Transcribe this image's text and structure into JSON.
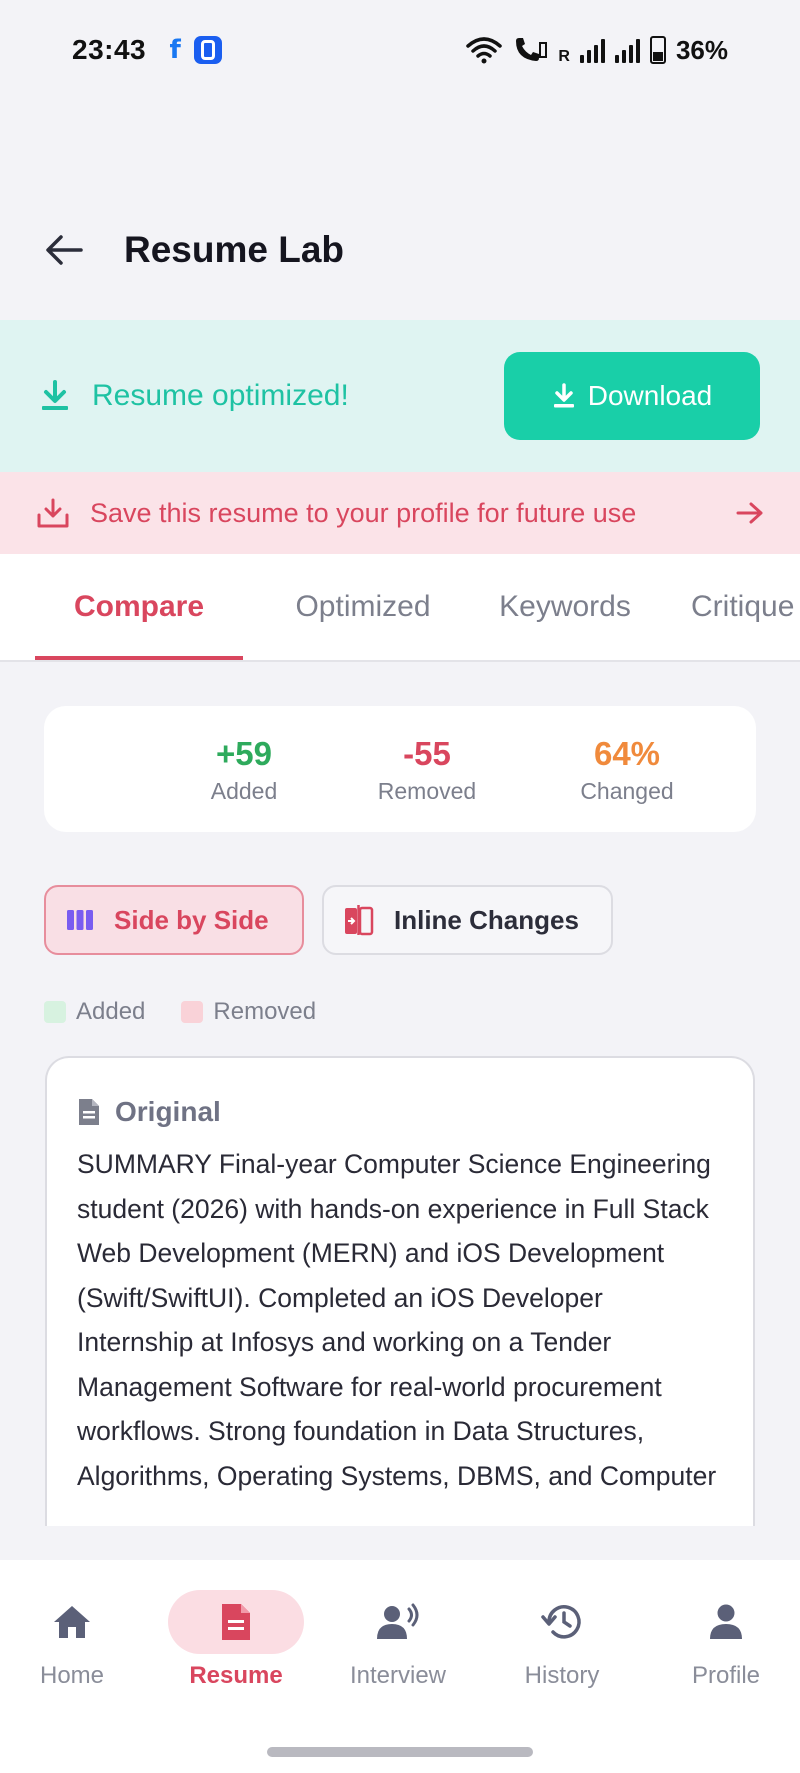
{
  "status": {
    "time": "23:43",
    "battery": "36%",
    "signal_marker": "R"
  },
  "header": {
    "title": "Resume Lab"
  },
  "banner": {
    "message": "Resume optimized!",
    "download_label": "Download"
  },
  "save_banner": {
    "text": "Save this resume to your profile for future use"
  },
  "tabs": [
    {
      "label": "Compare",
      "active": true
    },
    {
      "label": "Optimized",
      "active": false
    },
    {
      "label": "Keywords",
      "active": false
    },
    {
      "label": "Critique",
      "active": false
    }
  ],
  "stats": {
    "added": {
      "value": "+59",
      "label": "Added",
      "color": "#2eaa5c"
    },
    "removed": {
      "value": "-55",
      "label": "Removed",
      "color": "#d9465e"
    },
    "changed": {
      "value": "64%",
      "label": "Changed",
      "color": "#f08a3c"
    }
  },
  "view_toggle": {
    "side_by_side": "Side by Side",
    "inline": "Inline Changes"
  },
  "legend": {
    "added": "Added",
    "removed": "Removed",
    "added_color": "#d7f2e0",
    "removed_color": "#f9d2d8"
  },
  "original": {
    "title": "Original",
    "text": "SUMMARY Final-year Computer Science Engineering student (2026) with hands-on experience in Full Stack Web Development (MERN) and iOS Development (Swift/SwiftUI). Completed an iOS Developer Internship at Infosys and working on a Tender Management Software for real-world procurement workflows. Strong foundation in Data Structures, Algorithms, Operating Systems, DBMS, and Computer"
  },
  "nav": {
    "home": "Home",
    "resume": "Resume",
    "interview": "Interview",
    "history": "History",
    "profile": "Profile",
    "active": "resume"
  },
  "colors": {
    "accent": "#d9465e",
    "teal": "#19cfa8"
  }
}
